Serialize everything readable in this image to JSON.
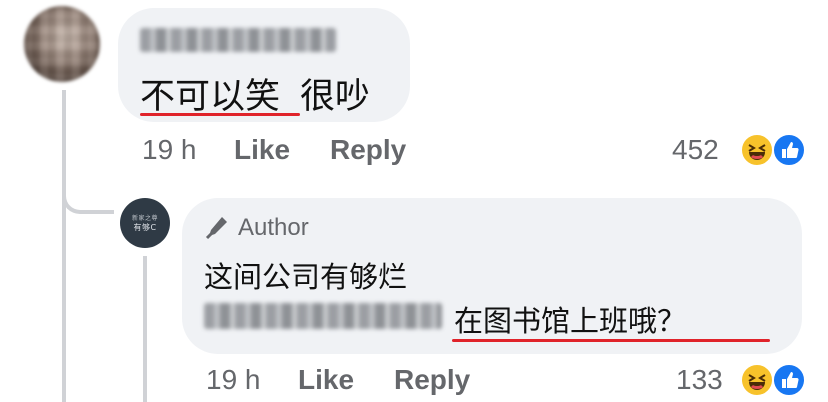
{
  "comments": [
    {
      "text_underlined": "不可以笑",
      "text_rest": "很吵",
      "time": "19 h",
      "like_label": "Like",
      "reply_label": "Reply",
      "reaction_count": "452"
    }
  ],
  "reply": {
    "author_badge": "Author",
    "line1": "这间公司有够烂",
    "line2_text": "在图书馆上班哦？",
    "time": "19 h",
    "like_label": "Like",
    "reply_label": "Reply",
    "reaction_count": "133",
    "avatar_label_top": "新家之尊",
    "avatar_label_main": "有够C"
  },
  "colors": {
    "bubble": "#f0f2f5",
    "meta_text": "#65676b",
    "highlight_underline": "#e0232a",
    "like_blue": "#1877f2",
    "haha_yellow": "#f7c22b"
  },
  "icons": [
    "haha-reaction-icon",
    "like-reaction-icon",
    "pen-icon"
  ]
}
